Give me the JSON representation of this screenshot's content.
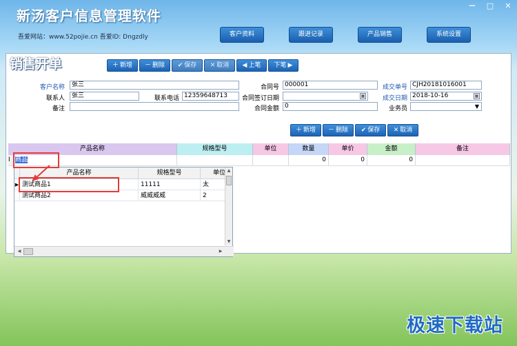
{
  "app": {
    "title": "新汤客户信息管理软件",
    "site_info": "吾爱网站：www.52pojie.cn  吾爱ID: Dngzdly",
    "window_controls": [
      "－",
      "□",
      "✕"
    ]
  },
  "nav": {
    "items": [
      "客户资料",
      "跟进记录",
      "产品销售",
      "系统设置"
    ]
  },
  "panel": {
    "title": "销售开单",
    "toolbar": {
      "add": "新增",
      "delete": "删除",
      "save": "保存",
      "cancel": "取消",
      "prev": "上笔",
      "next": "下笔"
    },
    "form": {
      "customer_name_label": "客户名称",
      "customer_name": "张三",
      "contact_label": "联系人",
      "contact": "张三",
      "phone_label": "联系电话",
      "phone": "12359648713",
      "remark_label": "备注",
      "remark": "",
      "contract_no_label": "合同号",
      "contract_no": "000001",
      "contract_date_label": "合同签订日期",
      "contract_date": "",
      "contract_amount_label": "合同金额",
      "contract_amount": "0",
      "deal_no_label": "成交单号",
      "deal_no": "CJH20181016001",
      "deal_date_label": "成交日期",
      "deal_date": "2018-10-16",
      "salesperson_label": "业务员",
      "salesperson": ""
    },
    "detail_toolbar": {
      "add": "新增",
      "delete": "删除",
      "save": "保存",
      "cancel": "取消"
    },
    "grid": {
      "columns": [
        "产品名称",
        "规格型号",
        "单位",
        "数量",
        "单价",
        "金额",
        "备注"
      ],
      "row": {
        "marker": "I",
        "product_name": "商品",
        "spec": "",
        "unit": "",
        "qty": "0",
        "price": "0",
        "amount": "0",
        "remark": ""
      }
    }
  },
  "popup": {
    "columns": [
      "产品名称",
      "规格型号",
      "单位"
    ],
    "rows": [
      {
        "name": "测试商品1",
        "spec": "11111",
        "unit": "太"
      },
      {
        "name": "测试商品2",
        "spec": "威威威威",
        "unit": "2"
      }
    ]
  },
  "watermark": "极速下载站",
  "colors": {
    "nav_button": "#1b5fae",
    "label_blue": "#1f57b3",
    "highlight_red": "#e23b3b",
    "col_purple": "#d9c7f0",
    "col_cyan": "#bdeff2",
    "col_blue": "#c6d6f7",
    "col_pink": "#f6c8e6",
    "col_green": "#c8f0c8"
  }
}
